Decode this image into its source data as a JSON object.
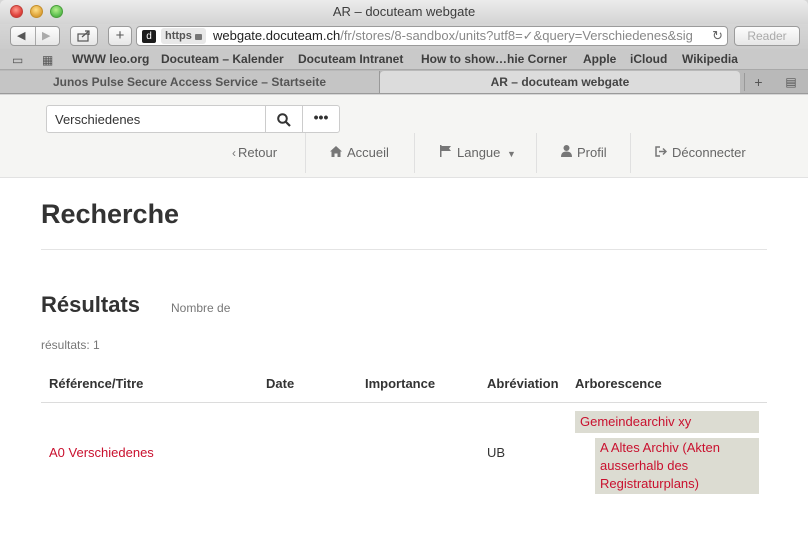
{
  "window": {
    "title": "AR – docuteam webgate"
  },
  "toolbar": {
    "url_scheme": "https",
    "url_domain": "webgate.docuteam.ch",
    "url_path": "/fr/stores/8-sandbox/units?utf8=✓&query=Verschiedenes&sig",
    "reader_label": "Reader",
    "plus_label": "+"
  },
  "bookmarks": [
    "WWW leo.org",
    "Docuteam – Kalender",
    "Docuteam Intranet",
    "How to show…hie Corner",
    "Apple",
    "iCloud",
    "Wikipedia"
  ],
  "tabs": [
    {
      "label": "Junos Pulse Secure Access Service – Startseite"
    },
    {
      "label": "AR – docuteam webgate"
    }
  ],
  "header": {
    "search_value": "Verschiedenes",
    "more_label": "•••",
    "nav": {
      "back": "Retour",
      "home": "Accueil",
      "language": "Langue",
      "profile": "Profil",
      "logout": "Déconnecter"
    }
  },
  "main": {
    "title": "Recherche",
    "results_title": "Résultats",
    "count_label_line1": "Nombre de",
    "count_label_line2": "résultats: 1",
    "columns": [
      "Référence/Titre",
      "Date",
      "Importance",
      "Abréviation",
      "Arborescence"
    ],
    "row": {
      "title": "A0 Verschiedenes",
      "abbreviation": "UB",
      "tree_level_1": "Gemeindearchiv xy",
      "tree_level_2": "A Altes Archiv (Akten ausserhalb des Registraturplans)"
    }
  },
  "colors": {
    "link": "#c9102e",
    "tree_bg": "#dcdcd2",
    "header_bg": "#f5f5f3"
  }
}
